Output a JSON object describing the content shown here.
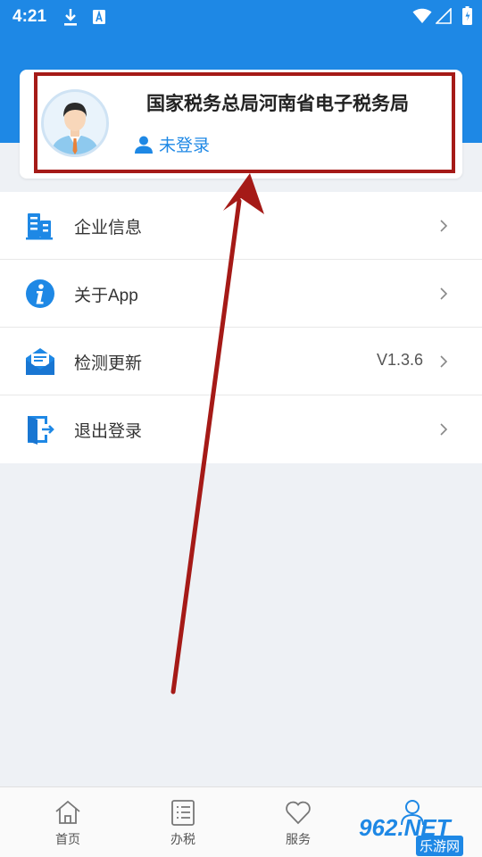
{
  "status_bar": {
    "time": "4:21"
  },
  "profile": {
    "org_name": "国家税务总局河南省电子税务局",
    "login_status": "未登录"
  },
  "menu": {
    "items": [
      {
        "label": "企业信息",
        "icon": "building-icon",
        "value": ""
      },
      {
        "label": "关于App",
        "icon": "info-icon",
        "value": ""
      },
      {
        "label": "检测更新",
        "icon": "mail-update-icon",
        "value": "V1.3.6"
      },
      {
        "label": "退出登录",
        "icon": "logout-door-icon",
        "value": ""
      }
    ]
  },
  "bottom_nav": {
    "items": [
      {
        "label": "首页",
        "icon": "home-icon"
      },
      {
        "label": "办税",
        "icon": "list-icon"
      },
      {
        "label": "服务",
        "icon": "heart-icon"
      }
    ]
  },
  "watermark": {
    "brand": "962.NET",
    "sub": "乐游网"
  },
  "colors": {
    "primary": "#1e88e5",
    "highlight": "#a51a17",
    "background": "#eef1f5"
  }
}
